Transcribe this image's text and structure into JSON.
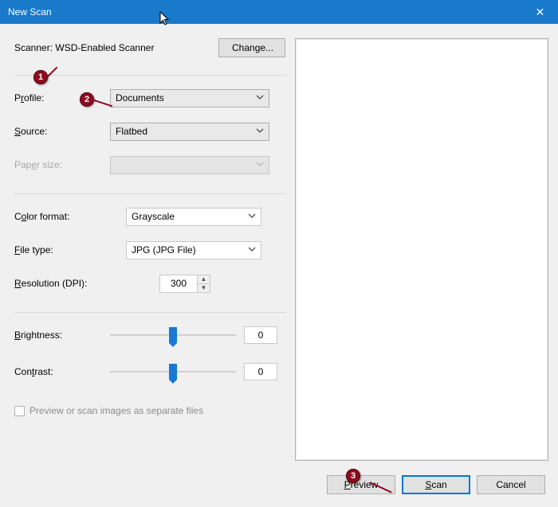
{
  "window": {
    "title": "New Scan",
    "close_glyph": "✕"
  },
  "scanner": {
    "prefix": "Scanner: ",
    "name": "WSD-Enabled Scanner",
    "change_label": "Change..."
  },
  "fields": {
    "profile": {
      "label_pre": "P",
      "label_ul": "r",
      "label_post": "ofile:",
      "value": "Documents"
    },
    "source": {
      "label_pre": "",
      "label_ul": "S",
      "label_post": "ource:",
      "value": "Flatbed"
    },
    "paper": {
      "label_pre": "Pap",
      "label_ul": "e",
      "label_post": "r size:",
      "value": ""
    },
    "color": {
      "label_pre": "C",
      "label_ul": "o",
      "label_post": "lor format:",
      "value": "Grayscale"
    },
    "filetype": {
      "label_pre": "",
      "label_ul": "F",
      "label_post": "ile type:",
      "value": "JPG (JPG File)"
    },
    "resolution": {
      "label_pre": "",
      "label_ul": "R",
      "label_post": "esolution (DPI):",
      "value": "300"
    },
    "brightness": {
      "label_pre": "",
      "label_ul": "B",
      "label_post": "rightness:",
      "value": "0"
    },
    "contrast": {
      "label_pre": "Con",
      "label_ul": "t",
      "label_post": "rast:",
      "value": "0"
    }
  },
  "checkbox": {
    "label": "Preview or scan images as separate files",
    "checked": false
  },
  "footer": {
    "preview_pre": "",
    "preview_ul": "P",
    "preview_post": "review",
    "scan_pre": "",
    "scan_ul": "S",
    "scan_post": "can",
    "cancel": "Cancel"
  },
  "annotations": {
    "b1": "1",
    "b2": "2",
    "b3": "3"
  }
}
